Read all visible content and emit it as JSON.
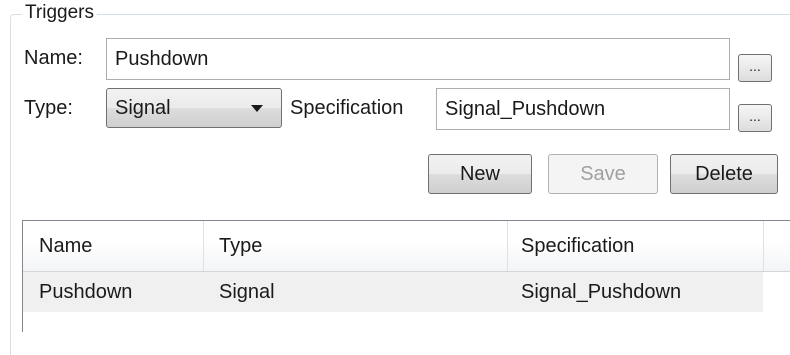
{
  "group": {
    "title": "Triggers"
  },
  "form": {
    "name_label": "Name:",
    "name_value": "Pushdown",
    "type_label": "Type:",
    "type_value": "Signal",
    "specification_label": "Specification",
    "specification_value": "Signal_Pushdown",
    "browse_label": "..."
  },
  "buttons": {
    "new": "New",
    "save": "Save",
    "delete": "Delete"
  },
  "grid": {
    "columns": [
      "Name",
      "Type",
      "Specification"
    ],
    "rows": [
      {
        "name": "Pushdown",
        "type": "Signal",
        "specification": "Signal_Pushdown"
      }
    ]
  }
}
